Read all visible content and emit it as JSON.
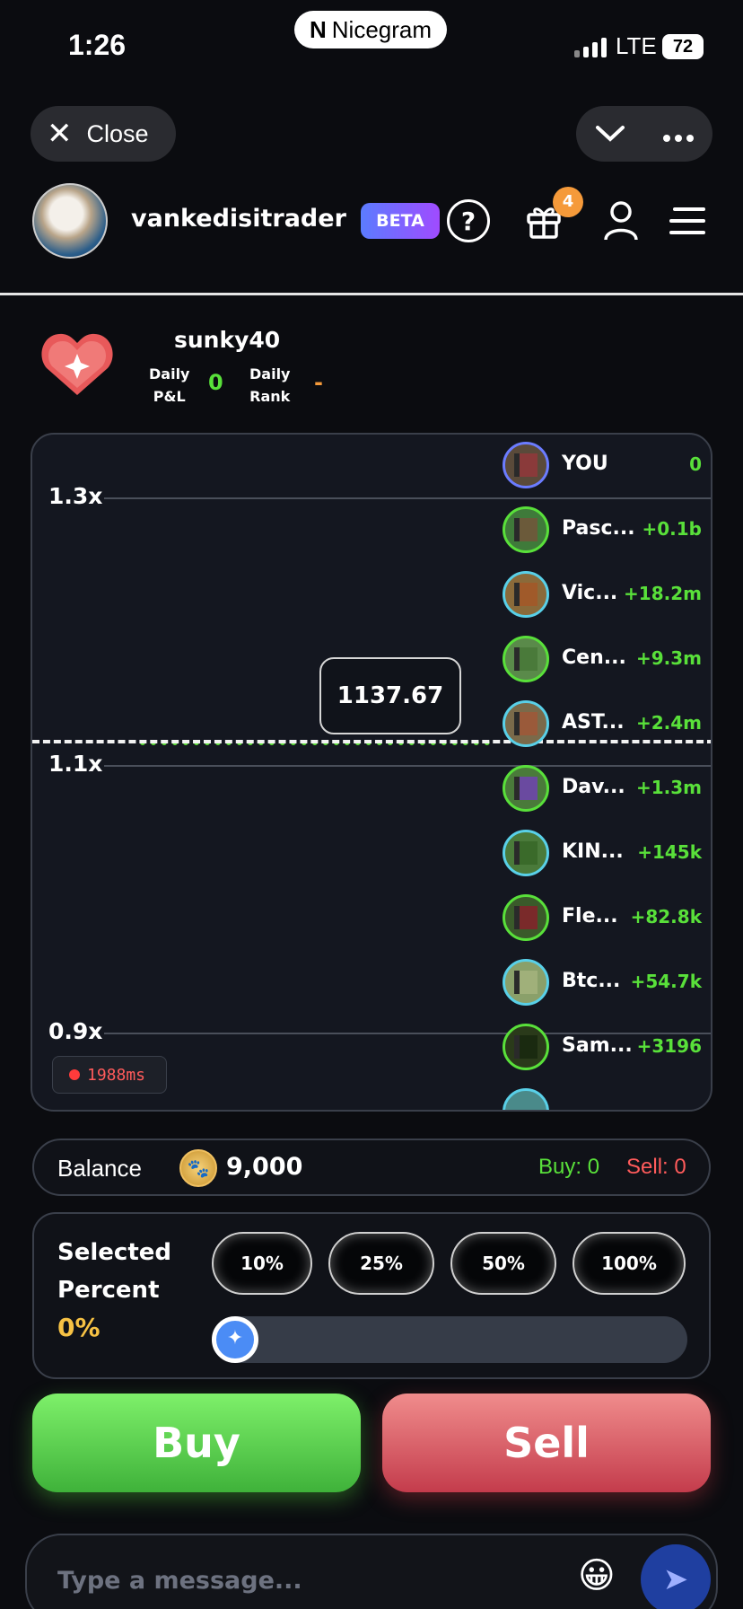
{
  "status": {
    "time": "1:26",
    "carrier_pill": "Nicegram",
    "network": "LTE",
    "battery": "72"
  },
  "top": {
    "close_label": "Close"
  },
  "header": {
    "username": "vankedisitrader",
    "beta_label": "BETA",
    "gift_badge_count": "4"
  },
  "profile": {
    "name": "sunky40",
    "pnl_label_line1": "Daily",
    "pnl_label_line2": "P&L",
    "pnl_value": "0",
    "rank_label_line1": "Daily",
    "rank_label_line2": "Rank",
    "rank_value": "-"
  },
  "chart": {
    "y_labels": [
      "1.3x",
      "1.1x",
      "0.9x"
    ],
    "current_price": "1137.67",
    "latency": "1988ms",
    "leaderboard": [
      {
        "name": "YOU",
        "value": "0"
      },
      {
        "name": "Pasc...",
        "value": "+0.1b"
      },
      {
        "name": "Vic...",
        "value": "+18.2m"
      },
      {
        "name": "Cen...",
        "value": "+9.3m"
      },
      {
        "name": "AST...",
        "value": "+2.4m"
      },
      {
        "name": "Dav...",
        "value": "+1.3m"
      },
      {
        "name": "KIN...",
        "value": "+145k"
      },
      {
        "name": "Fle...",
        "value": "+82.8k"
      },
      {
        "name": "Btc...",
        "value": "+54.7k"
      },
      {
        "name": "Sam...",
        "value": "+3196"
      }
    ]
  },
  "balance": {
    "label": "Balance",
    "value": "9,000",
    "buy_label": "Buy: 0",
    "sell_label": "Sell: 0"
  },
  "percent": {
    "title_line1": "Selected",
    "title_line2": "Percent",
    "value": "0%",
    "options": [
      "10%",
      "25%",
      "50%",
      "100%"
    ],
    "slider_fraction": 0
  },
  "actions": {
    "buy_label": "Buy",
    "sell_label": "Sell"
  },
  "chat": {
    "placeholder": "Type a message..."
  },
  "colors": {
    "green": "#59e03a",
    "red": "#ff5b5b",
    "orange": "#f59a3a",
    "yellow": "#f7c244",
    "blue": "#4b8cf5"
  }
}
